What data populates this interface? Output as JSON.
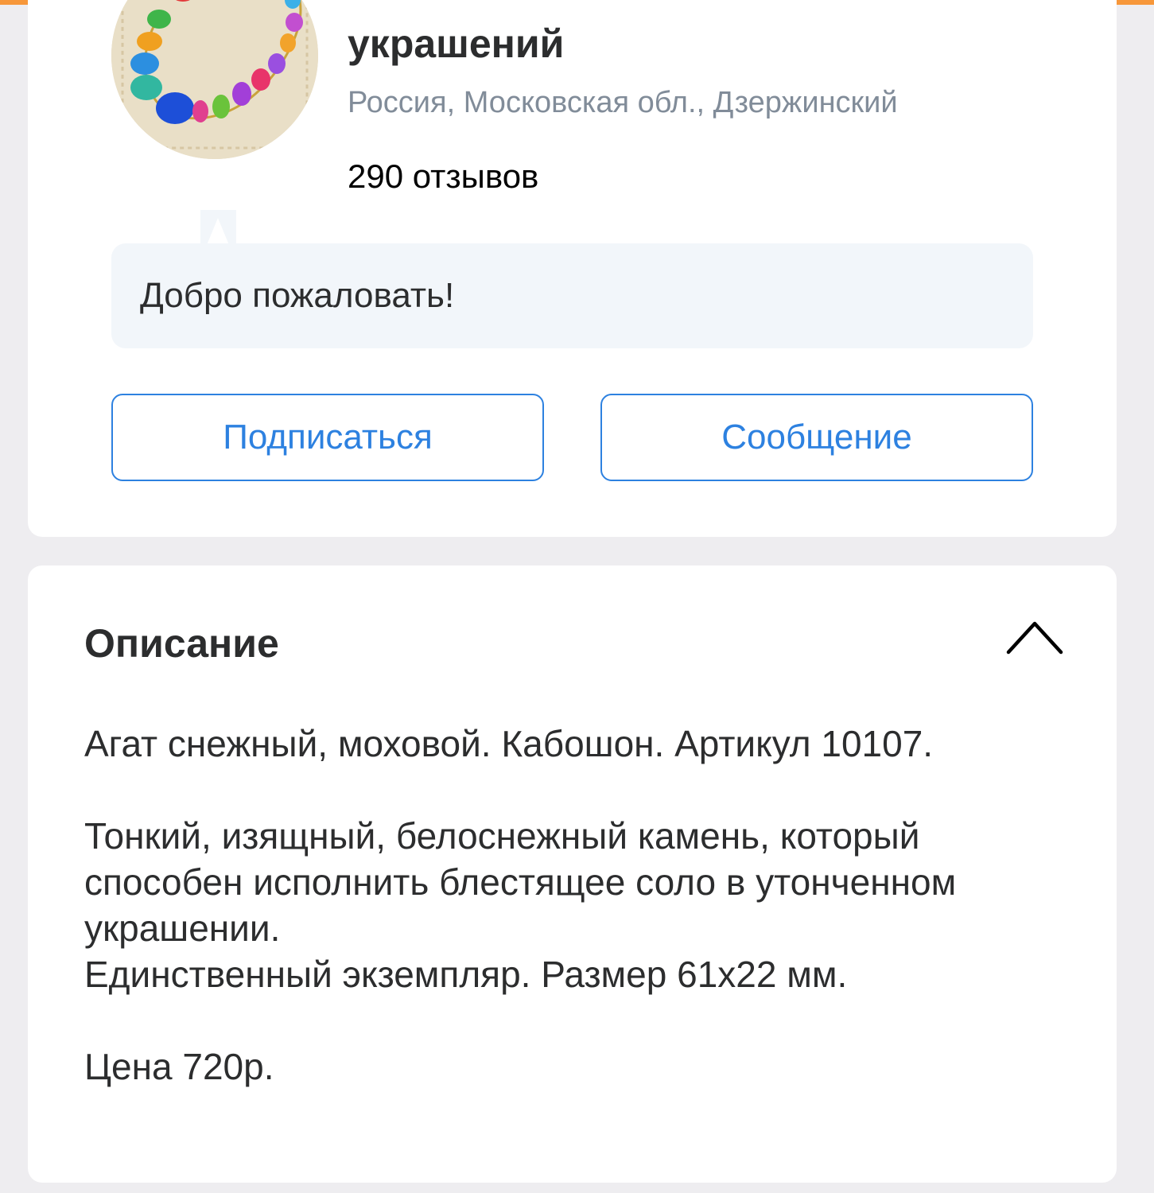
{
  "colors": {
    "accent_bar": "#f7973a",
    "button_blue": "#2d81e0",
    "page_background": "#eeedf0",
    "bubble_background": "#f2f6fa",
    "secondary_text": "#818c99"
  },
  "shop": {
    "title": "украшений",
    "location": "Россия, Московская обл., Дзержинский",
    "reviews": "290 отзывов",
    "avatar_icon": "bead-necklace-icon",
    "welcome_message": "Добро пожаловать!"
  },
  "actions": {
    "subscribe_label": "Подписаться",
    "message_label": "Сообщение"
  },
  "description": {
    "title": "Описание",
    "toggle_icon": "chevron-up-icon",
    "line1": "Агат снежный, моховой. Кабошон. Артикул 10107.",
    "line2": "Тонкий, изящный, белоснежный камень, который способен исполнить блестящее соло в утонченном украшении.",
    "line3": "Единственный экземпляр. Размер 61х22 мм.",
    "line4": "Цена 720р."
  }
}
